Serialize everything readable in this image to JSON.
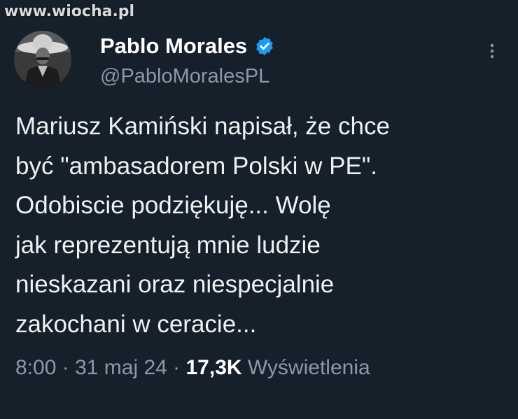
{
  "watermark": "www.wiocha.pl",
  "author": {
    "display_name": "Pablo Morales",
    "handle": "@PabloMoralesPL",
    "verified": true
  },
  "tweet": {
    "lines": [
      "Mariusz Kamiński napisał, że chce",
      "być \"ambasadorem Polski w PE\".",
      "Odobiscie podziękuję... Wolę",
      "jak reprezentują mnie ludzie",
      "nieskazani oraz niespecjalnie",
      "zakochani w ceracie..."
    ]
  },
  "meta": {
    "time": "8:00",
    "sep1": " · ",
    "date": "31 maj 24",
    "sep2": " · ",
    "views_count": "17,3K",
    "views_label": " Wyświetlenia"
  },
  "icons": {
    "verified": "verified-badge-icon",
    "more": "more-options-icon"
  },
  "colors": {
    "background": "#15202b",
    "verified": "#1d9bf0",
    "secondary_text": "#8b98a5"
  }
}
